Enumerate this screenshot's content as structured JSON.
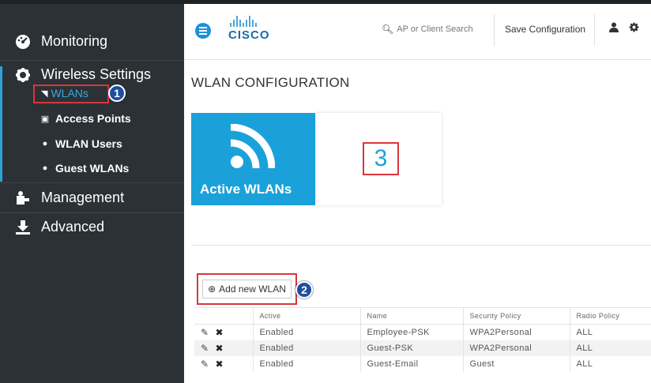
{
  "sidebar": {
    "monitoring": "Monitoring",
    "wireless_settings": "Wireless Settings",
    "wlans": "WLANs",
    "access_points": "Access Points",
    "wlan_users": "WLAN Users",
    "guest_wlans": "Guest WLANs",
    "management": "Management",
    "advanced": "Advanced"
  },
  "header": {
    "logo_text": "CISCO",
    "search_placeholder": "AP or Client Search",
    "save_configuration": "Save Configuration"
  },
  "main": {
    "title": "WLAN CONFIGURATION",
    "tile_label": "Active WLANs",
    "active_count": "3",
    "add_button": "Add new WLAN"
  },
  "annotations": [
    "1",
    "2"
  ],
  "table": {
    "columns": [
      "",
      "Active",
      "Name",
      "Security Policy",
      "Radio Policy"
    ],
    "rows": [
      {
        "active": "Enabled",
        "name": "Employee-PSK",
        "security": "WPA2Personal",
        "radio": "ALL"
      },
      {
        "active": "Enabled",
        "name": "Guest-PSK",
        "security": "WPA2Personal",
        "radio": "ALL"
      },
      {
        "active": "Enabled",
        "name": "Guest-Email",
        "security": "Guest",
        "radio": "ALL"
      }
    ]
  },
  "colors": {
    "sidebar_bg": "#2b3134",
    "accent_blue": "#1ba1d9",
    "highlight_red": "#d9363e",
    "badge_blue": "#1f4e9c"
  }
}
